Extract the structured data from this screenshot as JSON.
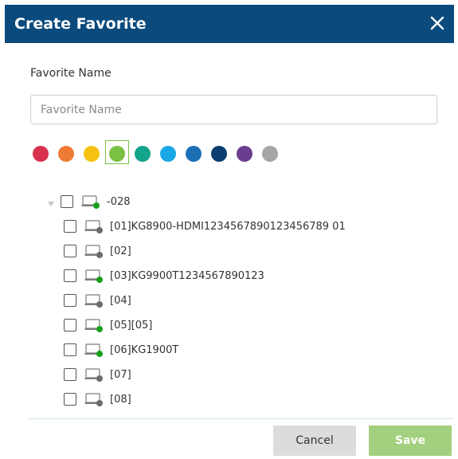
{
  "dialog": {
    "title": "Create Favorite",
    "close_icon": "close-icon"
  },
  "form": {
    "name_label": "Favorite Name",
    "name_placeholder": "Favorite Name",
    "name_value": ""
  },
  "colors": {
    "options": [
      "#d9304f",
      "#ef7a36",
      "#f5c211",
      "#7ac043",
      "#14a38b",
      "#1aa7e6",
      "#1d6fb5",
      "#0b3e70",
      "#6b3d8e",
      "#a6a6a6"
    ],
    "selected": "#7ac043"
  },
  "tree": {
    "root": {
      "label": "-028",
      "expanded": true,
      "checked": false,
      "status": "online"
    },
    "children": [
      {
        "label": "[01]KG8900-HDMI1234567890123456789 01",
        "checked": false,
        "status": "offline"
      },
      {
        "label": "[02]",
        "checked": false,
        "status": "offline"
      },
      {
        "label": "[03]KG9900T1234567890123",
        "checked": false,
        "status": "online"
      },
      {
        "label": "[04]",
        "checked": false,
        "status": "offline"
      },
      {
        "label": "[05][05]",
        "checked": false,
        "status": "online"
      },
      {
        "label": "[06]KG1900T",
        "checked": false,
        "status": "online"
      },
      {
        "label": "[07]",
        "checked": false,
        "status": "offline"
      },
      {
        "label": "[08]",
        "checked": false,
        "status": "offline"
      }
    ]
  },
  "status_colors": {
    "online": "#19a01b",
    "offline": "#6b6b6b"
  },
  "footer": {
    "cancel_label": "Cancel",
    "save_label": "Save"
  }
}
